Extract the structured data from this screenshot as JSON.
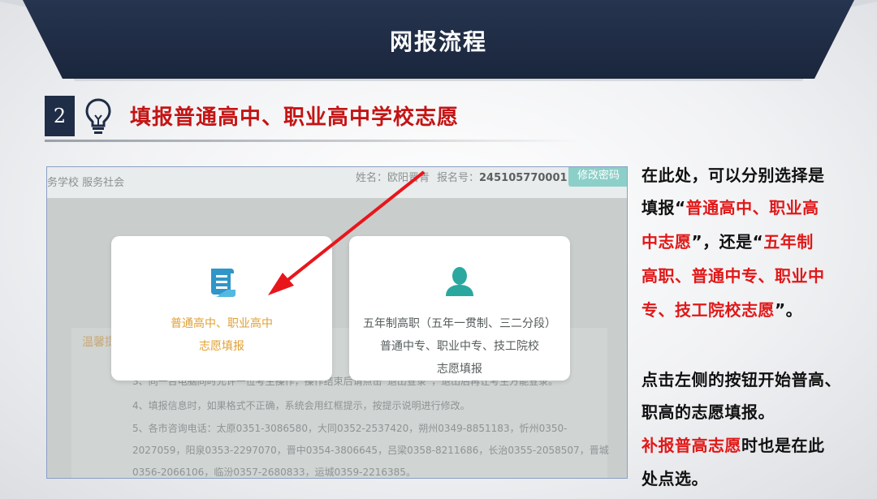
{
  "banner": {
    "title": "网报流程"
  },
  "step": {
    "number": "2",
    "title": "填报普通高中、职业高中学校志愿"
  },
  "screenshot": {
    "nav_text": "务学校   服务社会",
    "user_name": "姓名：欧阳晋青",
    "reg_label": "报名号：",
    "reg_number": "245105770001",
    "change_password": "修改密码",
    "notice_label": "温馨提",
    "card_left": {
      "line1": "普通高中、职业高中",
      "line2": "志愿填报"
    },
    "card_right": {
      "line1": "五年制高职（五年一贯制、三二分段）",
      "line2": "普通中专、职业中专、技工院校",
      "line3": "志愿填报"
    },
    "notice_lines": [
      "3、同一台电脑同时允许一位考生操作，操作结束后请点击“退出登录”，退出后再让考生方能登录。",
      "4、填报信息时，如果格式不正确，系统会用红框提示，按提示说明进行修改。",
      "5、各市咨询电话：太原0351-3086580，大同0352-2537420，朔州0349-8851183，忻州0350-",
      "2027059，阳泉0353-2297070，晋中0354-3806645，吕梁0358-8211686，长治0355-2058507，晋城",
      "0356-2066106，临汾0357-2680833，运城0359-2216385。"
    ]
  },
  "description": {
    "l1": "在此处，可以分别选择是",
    "l2a": "填报“",
    "l2b": "普通高中、职业高",
    "l3a": "中志愿",
    "l3b": "”，还是“",
    "l3c": "五年制",
    "l4": "高职、普通中专、职业中",
    "l5a": "专、技工院校志愿",
    "l5b": "”。",
    "l6": "点击左侧的按钮开始普高、",
    "l7": "职高的志愿填报。",
    "l8a": "补报普高志愿",
    "l8b": "时也是在此",
    "l9": "处点选。"
  },
  "colors": {
    "banner": "#1f2d46",
    "accent_red": "#e01818",
    "title_red": "#c41414",
    "teal": "#2aa8a0",
    "orange": "#e0a030"
  }
}
